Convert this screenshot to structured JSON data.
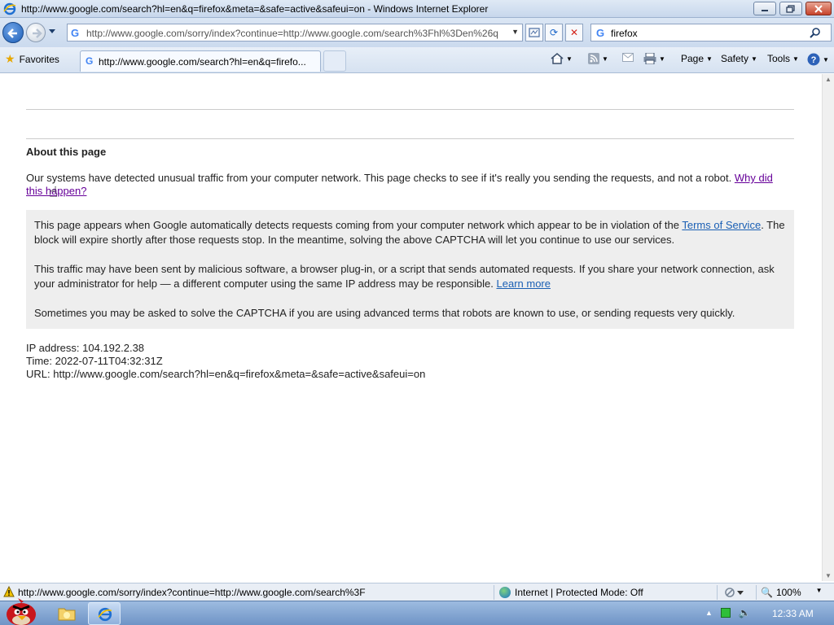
{
  "window": {
    "title": "http://www.google.com/search?hl=en&q=firefox&meta=&safe=active&safeui=on - Windows Internet Explorer"
  },
  "nav": {
    "address_url": "http://www.google.com/sorry/index?continue=http://www.google.com/search%3Fhl%3Den%26q",
    "search_value": "firefox"
  },
  "commandbar": {
    "favorites_label": "Favorites",
    "tab_label": "http://www.google.com/search?hl=en&q=firefo...",
    "page_label": "Page",
    "safety_label": "Safety",
    "tools_label": "Tools"
  },
  "page": {
    "heading": "About this page",
    "detected_text": "Our systems have detected unusual traffic from your computer network. This page checks to see if it's really you sending the requests, and not a robot.",
    "why_link": "Why did this happen?",
    "info_p1_text": "This page appears when Google automatically detects requests coming from your computer network which appear to be in violation of the",
    "info_p1_link": "Terms of Service",
    "info_p1_after": ". The block will expire shortly after those requests stop. In the meantime, solving the above CAPTCHA will let you continue to use our services.",
    "info_p2_text": "This traffic may have been sent by malicious software, a browser plug-in, or a script that sends automated requests. If you share your network connection, ask your administrator for help — a different computer using the same IP address may be responsible.",
    "info_p2_link": "Learn more",
    "info_p3_text": "Sometimes you may be asked to solve the CAPTCHA if you are using advanced terms that robots are known to use, or sending requests very quickly.",
    "ip_line": "IP address: 104.192.2.38",
    "time_line": "Time: 2022-07-11T04:32:31Z",
    "url_line": "URL: http://www.google.com/search?hl=en&q=firefox&meta=&safe=active&safeui=on"
  },
  "statusbar": {
    "url": "http://www.google.com/sorry/index?continue=http://www.google.com/search%3F",
    "zone": "Internet | Protected Mode: Off",
    "zoom": "100%"
  },
  "taskbar": {
    "clock": "12:33 AM"
  },
  "icons": {
    "back": "back-arrow-icon",
    "forward": "forward-arrow-icon",
    "refresh": "refresh-icon",
    "stop": "stop-icon",
    "search": "search-icon",
    "favorites": "star-icon",
    "home": "home-icon",
    "feeds": "rss-icon",
    "mail": "mail-icon",
    "print": "printer-icon",
    "help": "help-icon"
  }
}
